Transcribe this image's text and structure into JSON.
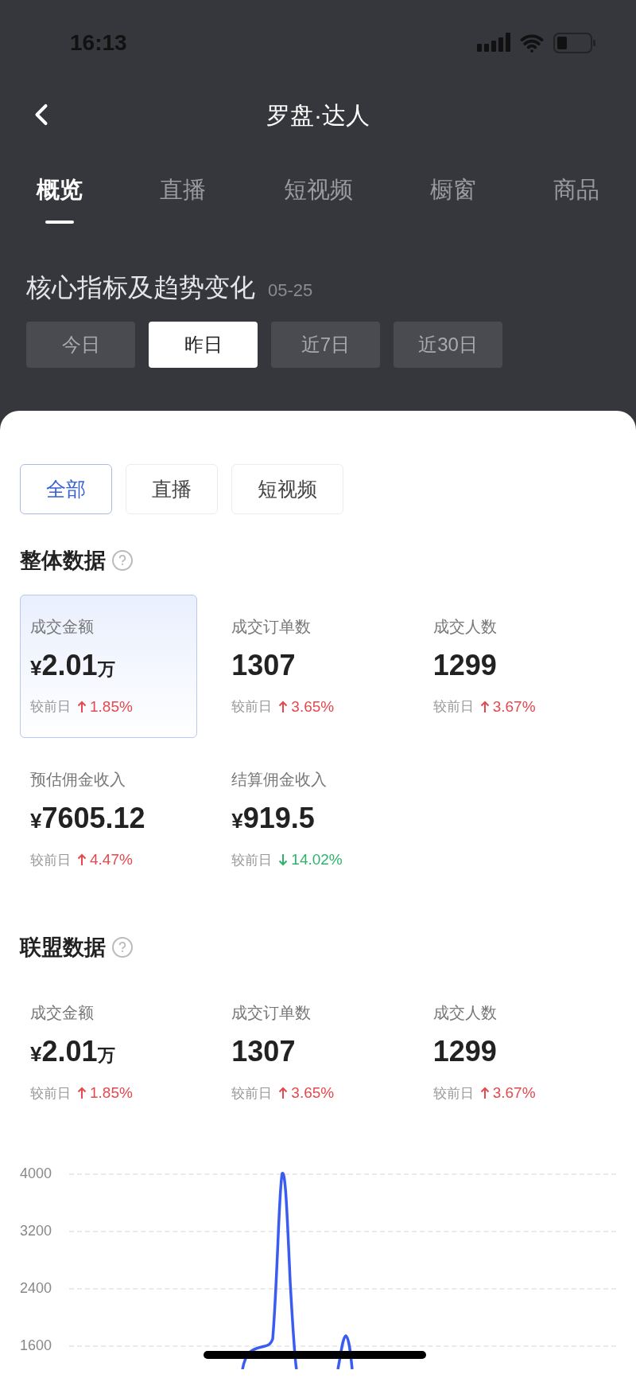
{
  "status_bar": {
    "time": "16:13"
  },
  "header": {
    "title": "罗盘·达人"
  },
  "tabs": [
    {
      "label": "概览",
      "selected": true
    },
    {
      "label": "直播",
      "selected": false
    },
    {
      "label": "短视频",
      "selected": false
    },
    {
      "label": "橱窗",
      "selected": false
    },
    {
      "label": "商品",
      "selected": false
    }
  ],
  "section": {
    "title": "核心指标及趋势变化",
    "date": "05-25"
  },
  "periods": [
    {
      "label": "今日",
      "selected": false
    },
    {
      "label": "昨日",
      "selected": true
    },
    {
      "label": "近7日",
      "selected": false
    },
    {
      "label": "近30日",
      "selected": false
    }
  ],
  "filters": [
    {
      "label": "全部",
      "selected": true
    },
    {
      "label": "直播",
      "selected": false
    },
    {
      "label": "短视频",
      "selected": false
    }
  ],
  "groups": [
    {
      "title": "整体数据",
      "metrics": [
        {
          "label": "成交金额",
          "currency": "¥",
          "amount": "2.01",
          "unit": "万",
          "compare": "较前日",
          "rising": true,
          "change": "1.85%",
          "selected": true
        },
        {
          "label": "成交订单数",
          "amount": "1307",
          "compare": "较前日",
          "rising": true,
          "change": "3.65%",
          "selected": false
        },
        {
          "label": "成交人数",
          "amount": "1299",
          "compare": "较前日",
          "rising": true,
          "change": "3.67%",
          "selected": false
        },
        {
          "label": "预估佣金收入",
          "currency": "¥",
          "amount": "7605.12",
          "compare": "较前日",
          "rising": true,
          "change": "4.47%",
          "selected": false
        },
        {
          "label": "结算佣金收入",
          "currency": "¥",
          "amount": "919.5",
          "compare": "较前日",
          "rising": false,
          "change": "14.02%",
          "selected": false
        }
      ]
    },
    {
      "title": "联盟数据",
      "metrics": [
        {
          "label": "成交金额",
          "currency": "¥",
          "amount": "2.01",
          "unit": "万",
          "compare": "较前日",
          "rising": true,
          "change": "1.85%",
          "selected": false
        },
        {
          "label": "成交订单数",
          "amount": "1307",
          "compare": "较前日",
          "rising": true,
          "change": "3.65%",
          "selected": false
        },
        {
          "label": "成交人数",
          "amount": "1299",
          "compare": "较前日",
          "rising": true,
          "change": "3.67%",
          "selected": false
        }
      ]
    }
  ],
  "trend_chart": {
    "y_tick_labels": [
      "4000",
      "3200",
      "2400",
      "1600"
    ]
  }
}
